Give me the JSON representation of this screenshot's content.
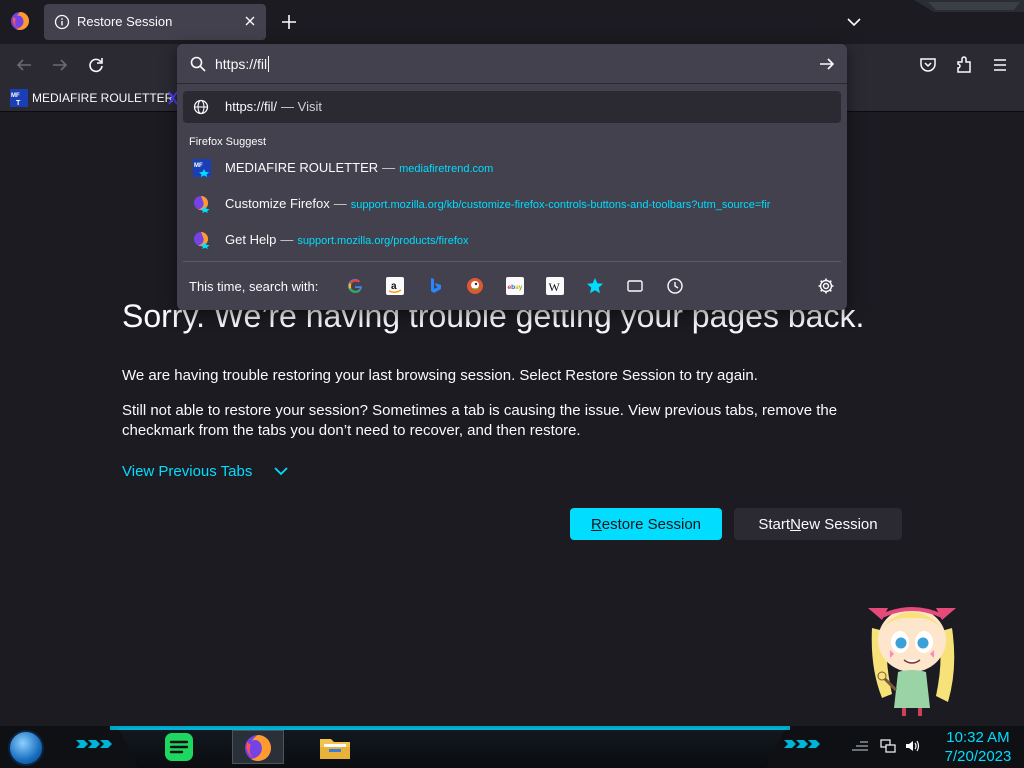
{
  "tab": {
    "title": "Restore Session"
  },
  "bookmarks": {
    "item1": "MEDIAFIRE ROULETTER"
  },
  "urlbar": {
    "value": "https://fil",
    "visit_url": "https://fil/",
    "visit_action": "Visit",
    "suggest_heading": "Firefox Suggest",
    "suggestions": [
      {
        "title": "MEDIAFIRE ROULETTER",
        "url": "mediafiretrend.com"
      },
      {
        "title": "Customize Firefox",
        "url": "support.mozilla.org/kb/customize-firefox-controls-buttons-and-toolbars?utm_source=fir"
      },
      {
        "title": "Get Help",
        "url": "support.mozilla.org/products/firefox"
      }
    ],
    "search_with_label": "This time, search with:",
    "engines": [
      "google-icon",
      "amazon-icon",
      "bing-icon",
      "duckduckgo-icon",
      "ebay-icon",
      "wikipedia-icon",
      "bookmarks-star-icon",
      "tabs-icon",
      "history-icon"
    ]
  },
  "page": {
    "heading": "Sorry. We’re having trouble getting your pages back.",
    "para1": "We are having trouble restoring your last browsing session. Select Restore Session to try again.",
    "para2": "Still not able to restore your session? Sometimes a tab is causing the issue. View previous tabs, remove the checkmark from the tabs you don’t need to recover, and then restore.",
    "view_previous": "View Previous Tabs",
    "restore_btn": {
      "pre": "",
      "u": "R",
      "post": "estore Session"
    },
    "new_btn": {
      "pre": "Start ",
      "u": "N",
      "post": "ew Session"
    }
  },
  "taskbar": {
    "time": "10:32 AM",
    "date": "7/20/2023"
  },
  "colors": {
    "accent": "#00ddff",
    "bg": "#1c1b22",
    "toolbar": "#2b2a33",
    "panel": "#42414d"
  }
}
